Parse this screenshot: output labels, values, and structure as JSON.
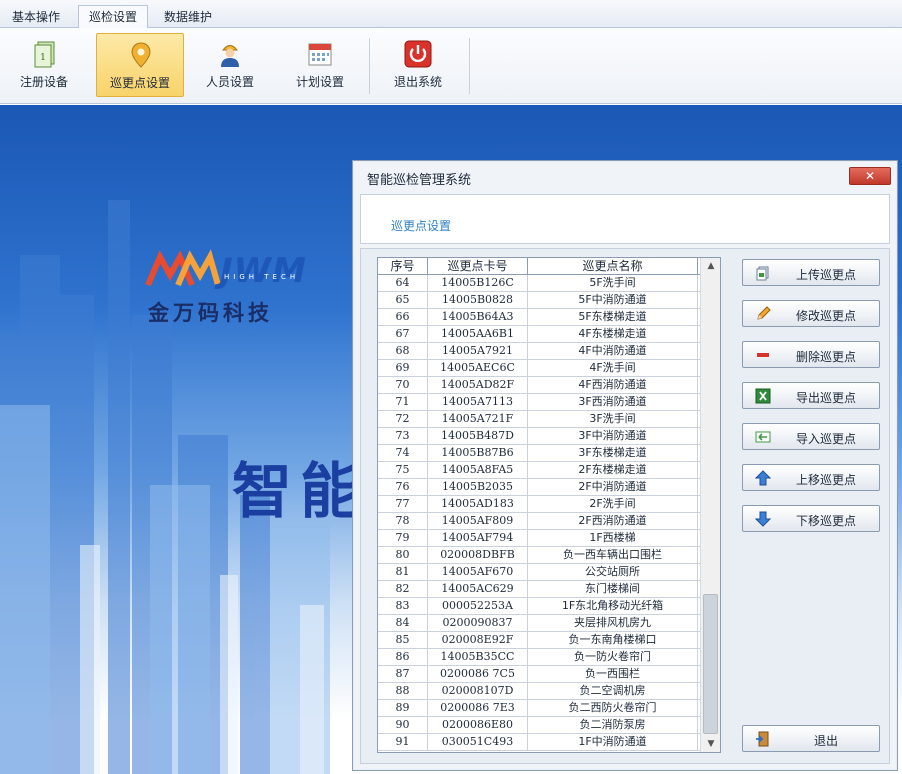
{
  "menu": {
    "tabs": [
      {
        "label": "基本操作"
      },
      {
        "label": "巡检设置",
        "active": true
      },
      {
        "label": "数据维护"
      }
    ]
  },
  "ribbon": {
    "buttons": [
      {
        "label": "注册设备",
        "icon": "register-device-icon"
      },
      {
        "label": "巡更点设置",
        "icon": "location-pin-icon",
        "active": true
      },
      {
        "label": "人员设置",
        "icon": "worker-icon"
      },
      {
        "label": "计划设置",
        "icon": "calendar-icon"
      },
      {
        "label": "退出系统",
        "icon": "power-icon"
      }
    ]
  },
  "background": {
    "logo": "JWM",
    "logo_sub": "HIGH TECH",
    "company": "金万码科技",
    "title": "智能"
  },
  "dialog": {
    "title": "智能巡检管理系统",
    "close_label": "✕",
    "header_title": "巡更点设置",
    "table": {
      "columns": [
        "序号",
        "巡更点卡号",
        "巡更点名称"
      ],
      "rows": [
        [
          "64",
          "14005B126C",
          "5F洗手间"
        ],
        [
          "65",
          "14005B0828",
          "5F中消防通道"
        ],
        [
          "66",
          "14005B64A3",
          "5F东楼梯走道"
        ],
        [
          "67",
          "14005AA6B1",
          "4F东楼梯走道"
        ],
        [
          "68",
          "14005A7921",
          "4F中消防通道"
        ],
        [
          "69",
          "14005AEC6C",
          "4F洗手间"
        ],
        [
          "70",
          "14005AD82F",
          "4F西消防通道"
        ],
        [
          "71",
          "14005A7113",
          "3F西消防通道"
        ],
        [
          "72",
          "14005A721F",
          "3F洗手间"
        ],
        [
          "73",
          "14005B487D",
          "3F中消防通道"
        ],
        [
          "74",
          "14005B87B6",
          "3F东楼梯走道"
        ],
        [
          "75",
          "14005A8FA5",
          "2F东楼梯走道"
        ],
        [
          "76",
          "14005B2035",
          "2F中消防通道"
        ],
        [
          "77",
          "14005AD183",
          "2F洗手间"
        ],
        [
          "78",
          "14005AF809",
          "2F西消防通道"
        ],
        [
          "79",
          "14005AF794",
          "1F西楼梯"
        ],
        [
          "80",
          "020008DBFB",
          "负一西车辆出口围栏"
        ],
        [
          "81",
          "14005AF670",
          "公交站厕所"
        ],
        [
          "82",
          "14005AC629",
          "东门楼梯间"
        ],
        [
          "83",
          "000052253A",
          "1F东北角移动光纤箱"
        ],
        [
          "84",
          "0200090837",
          "夹层排风机房九"
        ],
        [
          "85",
          "020008E92F",
          "负一东南角楼梯口"
        ],
        [
          "86",
          "14005B35CC",
          "负一防火卷帘门"
        ],
        [
          "87",
          "0200086 7C5",
          "负一西围栏"
        ],
        [
          "88",
          "020008107D",
          "负二空调机房"
        ],
        [
          "89",
          "0200086 7E3",
          "负二西防火卷帘门"
        ],
        [
          "90",
          "0200086E80",
          "负二消防泵房"
        ],
        [
          "91",
          "030051C493",
          "1F中消防通道"
        ]
      ]
    },
    "buttons": [
      {
        "label": "上传巡更点",
        "icon": "upload-icon"
      },
      {
        "label": "修改巡更点",
        "icon": "pencil-icon"
      },
      {
        "label": "删除巡更点",
        "icon": "minus-icon"
      },
      {
        "label": "导出巡更点",
        "icon": "excel-icon"
      },
      {
        "label": "导入巡更点",
        "icon": "import-icon"
      },
      {
        "label": "上移巡更点",
        "icon": "arrow-up-icon"
      },
      {
        "label": "下移巡更点",
        "icon": "arrow-down-icon"
      }
    ],
    "exit_button": {
      "label": "退出",
      "icon": "exit-door-icon"
    }
  }
}
